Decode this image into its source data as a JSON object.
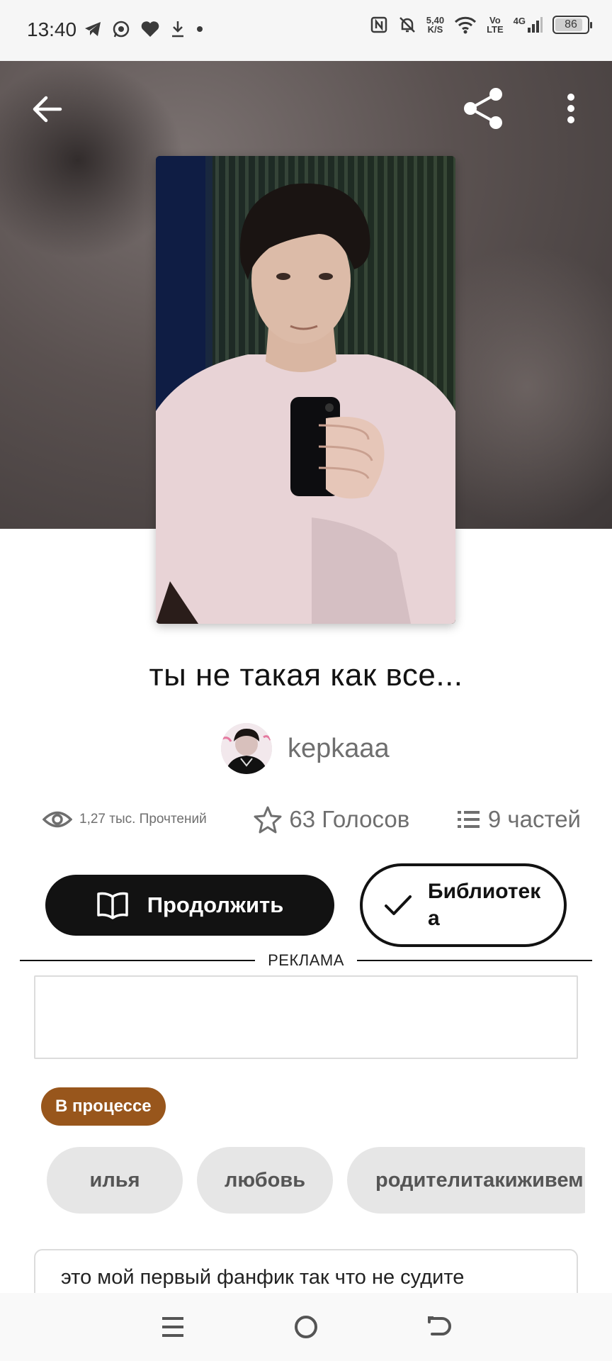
{
  "status_bar": {
    "time": "13:40",
    "net_speed": "5,40",
    "net_speed_unit": "K/S",
    "volte_top": "Vo",
    "volte_bottom": "LTE",
    "signal_label": "4G",
    "battery": "86",
    "battery_level": 0.86
  },
  "header": {
    "back_icon": "arrow-left-icon",
    "share_icon": "share-icon",
    "more_icon": "more-vertical-icon"
  },
  "story": {
    "title": "ты не такая как все...",
    "author": "kepkaaa",
    "reads": "1,27 тыс. Прочтений",
    "votes": "63 Голосов",
    "parts": "9 частей",
    "continue_label": "Продолжить",
    "library_label": "Библиотека",
    "ad_label": "РЕКЛАМА",
    "status_badge": "В процессе",
    "tags": [
      "илья",
      "любовь",
      "родителитакиживем"
    ],
    "description": "это мой первый фанфик так что не судите"
  },
  "colors": {
    "primary": "#121212",
    "badge": "#98561c",
    "tag_bg": "#e6e6e6",
    "muted_text": "#6f6f6f"
  }
}
